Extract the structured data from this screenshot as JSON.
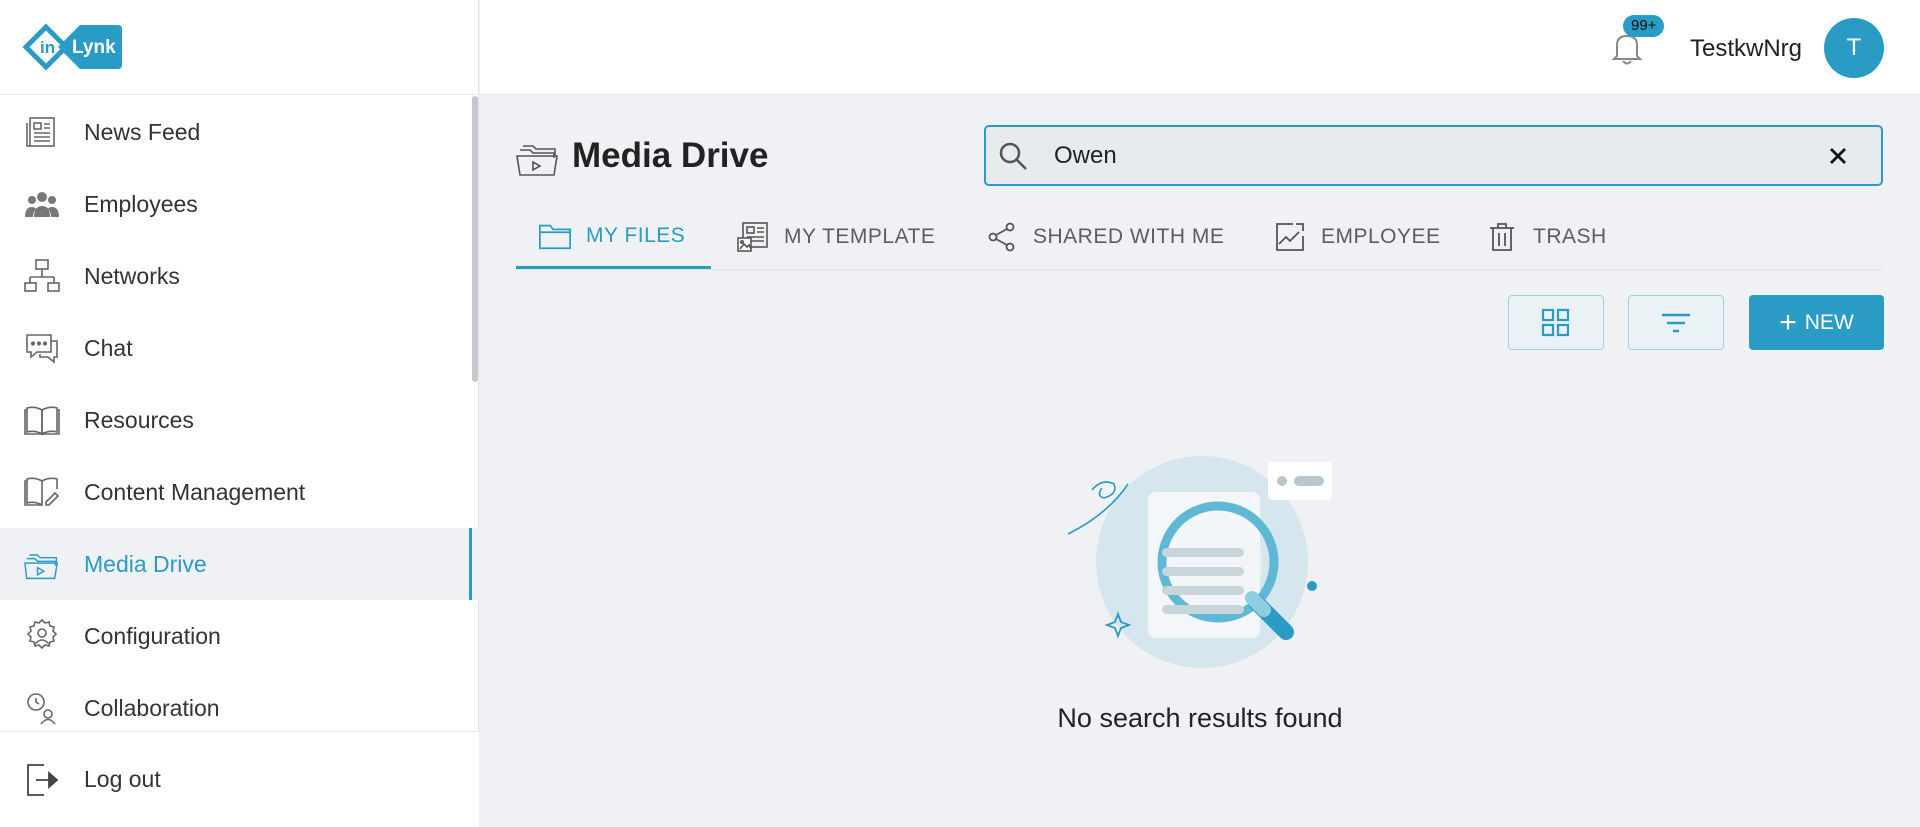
{
  "brand": {
    "logo_text_left": "in",
    "logo_text_right": "Lynk"
  },
  "sidebar": {
    "items": [
      {
        "label": "News Feed",
        "icon": "newspaper-icon"
      },
      {
        "label": "Employees",
        "icon": "people-icon"
      },
      {
        "label": "Networks",
        "icon": "network-icon"
      },
      {
        "label": "Chat",
        "icon": "chat-icon"
      },
      {
        "label": "Resources",
        "icon": "book-icon"
      },
      {
        "label": "Content Management",
        "icon": "book-edit-icon"
      },
      {
        "label": "Media Drive",
        "icon": "media-folder-icon",
        "active": true
      },
      {
        "label": "Configuration",
        "icon": "gear-person-icon"
      },
      {
        "label": "Collaboration",
        "icon": "collaboration-icon"
      }
    ],
    "logout_label": "Log out"
  },
  "header": {
    "notification_badge": "99+",
    "username": "TestkwNrg",
    "avatar_initial": "T"
  },
  "main": {
    "title": "Media Drive",
    "search": {
      "value": "Owen",
      "placeholder": ""
    },
    "tabs": [
      {
        "label": "MY FILES",
        "icon": "folder-icon",
        "active": true
      },
      {
        "label": "MY TEMPLATE",
        "icon": "template-icon"
      },
      {
        "label": "SHARED WITH ME",
        "icon": "share-icon"
      },
      {
        "label": "EMPLOYEE",
        "icon": "image-chart-icon"
      },
      {
        "label": "TRASH",
        "icon": "trash-icon"
      }
    ],
    "new_button_label": "NEW",
    "empty_message": "No search results found"
  },
  "colors": {
    "accent": "#2a9bc4",
    "background": "#eff1f5"
  }
}
